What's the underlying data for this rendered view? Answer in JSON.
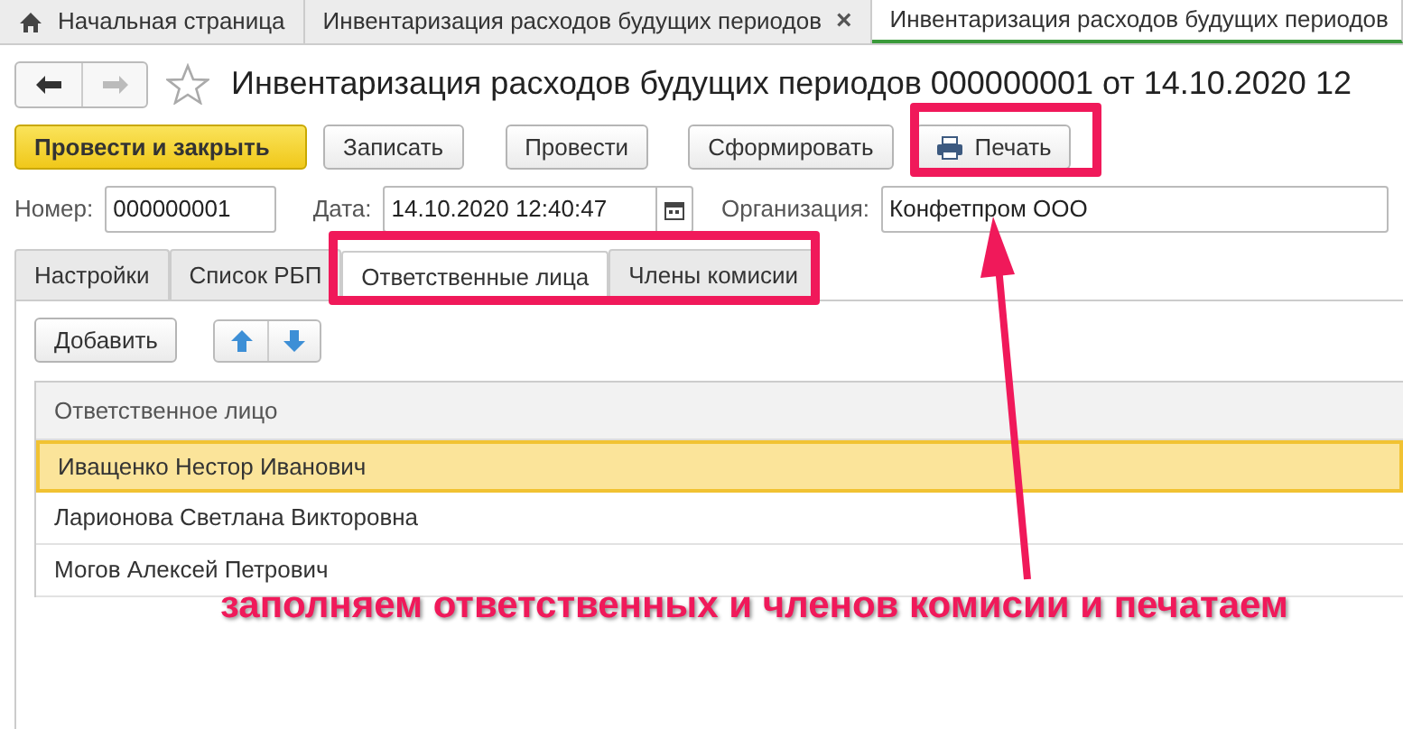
{
  "tabs": [
    {
      "kind": "home",
      "label": "Начальная страница",
      "selected": false
    },
    {
      "kind": "document",
      "label": "Инвентаризация расходов будущих периодов",
      "close": "×",
      "selected": false
    },
    {
      "kind": "document",
      "label": "Инвентаризация расходов будущих периодов",
      "selected": true
    }
  ],
  "title": "Инвентаризация расходов будущих периодов 000000001 от 14.10.2020 12",
  "commands": [
    {
      "kind": "default",
      "label": "Провести и закрыть"
    },
    {
      "kind": "plain",
      "label": "Записать"
    },
    {
      "kind": "plain",
      "label": "Провести"
    },
    {
      "kind": "plain",
      "label": "Сформировать"
    },
    {
      "kind": "print",
      "label": "Печать"
    }
  ],
  "fields": [
    {
      "kind": "text",
      "label": "Номер:",
      "value": "000000001"
    },
    {
      "kind": "date",
      "label": "Дата:",
      "value": "14.10.2020 12:40:47"
    },
    {
      "kind": "text",
      "label": "Организация:",
      "value": "Конфетпром ООО"
    }
  ],
  "form_tabs": [
    {
      "label": "Настройки",
      "selected": false
    },
    {
      "label": "Список РБП",
      "selected": false
    },
    {
      "label": "Ответственные лица",
      "selected": true
    },
    {
      "label": "Члены комисии",
      "selected": false
    }
  ],
  "table_toolbar": {
    "add": "Добавить"
  },
  "table": {
    "columns": [
      "Ответственное лицо"
    ],
    "rows": [
      {
        "cells": [
          "Иващенко Нестор Иванович"
        ],
        "selected": true
      },
      {
        "cells": [
          "Ларионова Светлана Викторовна"
        ],
        "selected": false
      },
      {
        "cells": [
          "Могов Алексей Петрович"
        ],
        "selected": false
      }
    ]
  },
  "annotation": {
    "text": "заполняем ответственных и членов комисии и печатаем"
  }
}
